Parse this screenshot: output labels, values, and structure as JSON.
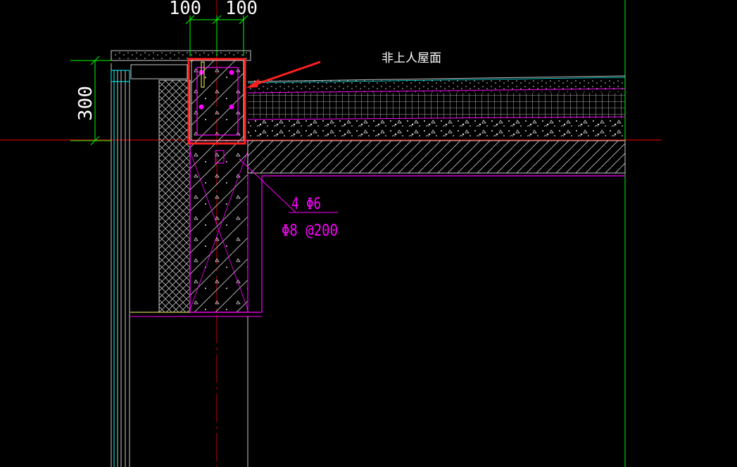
{
  "dimensions": {
    "top_left": "100",
    "top_right": "100",
    "height": "300"
  },
  "labels": {
    "roof": "非上人屋面",
    "rebar_main": "4 Φ6",
    "rebar_stirrup": "Φ8 @200"
  },
  "colors": {
    "background": "#000000",
    "structure": "#ff00ff",
    "dimension": "#00ff00",
    "highlight": "#ff2020",
    "text_white": "#ffffff",
    "cyan": "#00ffff",
    "yellow": "#ffff66",
    "red_axis": "#ff0000",
    "grey": "#c8c8c8"
  }
}
